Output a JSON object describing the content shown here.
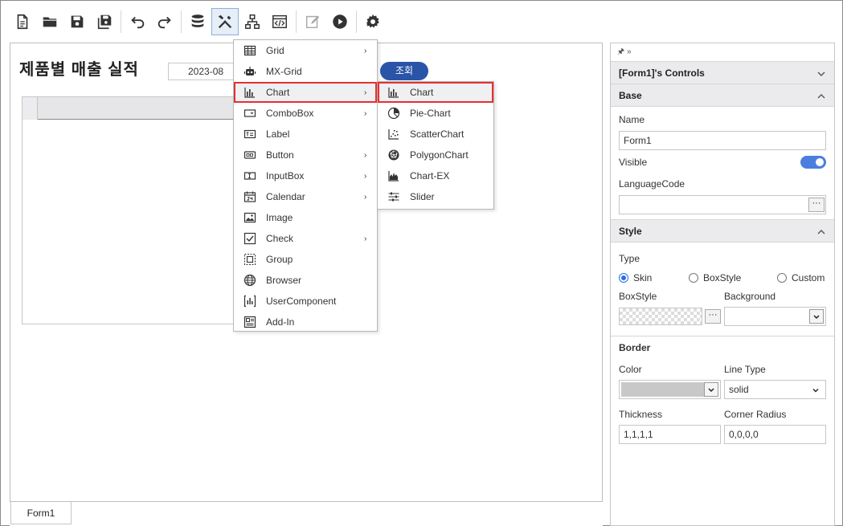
{
  "toolbar": {
    "icons": [
      "new-file-icon",
      "open-folder-icon",
      "save-icon",
      "save-all-icon",
      "undo-icon",
      "redo-icon",
      "database-icon",
      "tools-icon",
      "hierarchy-icon",
      "code-icon",
      "edit-icon",
      "run-icon",
      "gear-icon"
    ]
  },
  "form": {
    "title": "제품별 매출 실적",
    "date_value": "2023-08",
    "search_label": "조회",
    "tab_label": "Form1"
  },
  "menu": {
    "items": [
      {
        "label": "Grid",
        "icon": "grid-icon",
        "has_submenu": true
      },
      {
        "label": "MX-Grid",
        "icon": "robot-icon",
        "has_submenu": false
      },
      {
        "label": "Chart",
        "icon": "bar-chart-icon",
        "has_submenu": true
      },
      {
        "label": "ComboBox",
        "icon": "combobox-icon",
        "has_submenu": true
      },
      {
        "label": "Label",
        "icon": "label-icon",
        "has_submenu": false
      },
      {
        "label": "Button",
        "icon": "button-icon",
        "has_submenu": true
      },
      {
        "label": "InputBox",
        "icon": "inputbox-icon",
        "has_submenu": true
      },
      {
        "label": "Calendar",
        "icon": "calendar-icon",
        "has_submenu": true
      },
      {
        "label": "Image",
        "icon": "image-icon",
        "has_submenu": false
      },
      {
        "label": "Check",
        "icon": "checkbox-icon",
        "has_submenu": true
      },
      {
        "label": "Group",
        "icon": "group-icon",
        "has_submenu": false
      },
      {
        "label": "Browser",
        "icon": "globe-icon",
        "has_submenu": false
      },
      {
        "label": "UserComponent",
        "icon": "user-component-icon",
        "has_submenu": false
      },
      {
        "label": "Add-In",
        "icon": "add-in-icon",
        "has_submenu": false
      }
    ],
    "arrow": "›"
  },
  "submenu": {
    "items": [
      {
        "label": "Chart",
        "icon": "bar-chart-icon"
      },
      {
        "label": "Pie-Chart",
        "icon": "pie-chart-icon"
      },
      {
        "label": "ScatterChart",
        "icon": "scatter-chart-icon"
      },
      {
        "label": "PolygonChart",
        "icon": "polygon-chart-icon"
      },
      {
        "label": "Chart-EX",
        "icon": "area-chart-icon"
      },
      {
        "label": "Slider",
        "icon": "slider-icon"
      }
    ]
  },
  "panel": {
    "pin_glyph": "🖈 »",
    "title": "[Form1]'s Controls",
    "base": {
      "header": "Base",
      "name_label": "Name",
      "name_value": "Form1",
      "visible_label": "Visible",
      "language_label": "LanguageCode",
      "language_value": "",
      "dots": "···"
    },
    "style": {
      "header": "Style",
      "type_label": "Type",
      "types": [
        "Skin",
        "BoxStyle",
        "Custom"
      ],
      "selected_type": "Skin",
      "boxstyle_label": "BoxStyle",
      "background_label": "Background"
    },
    "border": {
      "header": "Border",
      "color_label": "Color",
      "linetype_label": "Line Type",
      "linetype_value": "solid",
      "thickness_label": "Thickness",
      "thickness_value": "1,1,1,1",
      "radius_label": "Corner Radius",
      "radius_value": "0,0,0,0"
    }
  },
  "colors": {
    "accent": "#2a54a8",
    "highlight_border": "#e53030",
    "toggle_on": "#4a7fe0",
    "color_swatch": "#c8c8c8"
  }
}
